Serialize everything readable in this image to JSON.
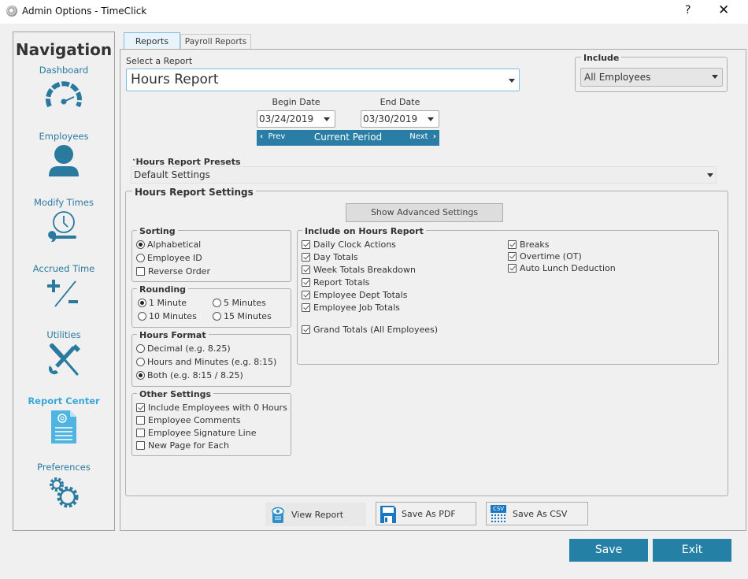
{
  "window": {
    "title": "Admin Options - TimeClick",
    "help_label": "?",
    "close_label": "✕"
  },
  "navigation": {
    "title": "Navigation",
    "items": [
      {
        "label": "Dashboard",
        "icon": "speedometer-icon",
        "active": false
      },
      {
        "label": "Employees",
        "icon": "person-icon",
        "active": false
      },
      {
        "label": "Modify Times",
        "icon": "clock-wrench-icon",
        "active": false
      },
      {
        "label": "Accrued Time",
        "icon": "plus-minus-icon",
        "active": false
      },
      {
        "label": "Utilities",
        "icon": "tools-icon",
        "active": false
      },
      {
        "label": "Report Center",
        "icon": "report-document-icon",
        "active": true
      },
      {
        "label": "Preferences",
        "icon": "gears-icon",
        "active": false
      }
    ]
  },
  "tabs": [
    {
      "label": "Reports",
      "active": true
    },
    {
      "label": "Payroll Reports",
      "active": false
    }
  ],
  "report": {
    "select_label": "Select a Report",
    "selected": "Hours Report"
  },
  "include": {
    "legend": "Include",
    "selected": "All Employees"
  },
  "dates": {
    "begin_label": "Begin Date",
    "begin_value": "03/24/2019",
    "end_label": "End Date",
    "end_value": "03/30/2019",
    "prev_label": "Prev",
    "current_label": "Current Period",
    "next_label": "Next"
  },
  "presets": {
    "label": "Hours Report Presets",
    "selected": "Default Settings"
  },
  "settings": {
    "legend": "Hours Report Settings",
    "advanced_button": "Show Advanced Settings",
    "sorting": {
      "legend": "Sorting",
      "options": [
        {
          "label": "Alphabetical",
          "type": "radio",
          "checked": true
        },
        {
          "label": "Employee ID",
          "type": "radio",
          "checked": false
        },
        {
          "label": "Reverse Order",
          "type": "checkbox",
          "checked": false
        }
      ]
    },
    "rounding": {
      "legend": "Rounding",
      "options": [
        {
          "label": "1 Minute",
          "checked": true
        },
        {
          "label": "5 Minutes",
          "checked": false
        },
        {
          "label": "10 Minutes",
          "checked": false
        },
        {
          "label": "15 Minutes",
          "checked": false
        }
      ]
    },
    "hours_format": {
      "legend": "Hours Format",
      "options": [
        {
          "label": "Decimal (e.g. 8.25)",
          "checked": false
        },
        {
          "label": "Hours and Minutes (e.g. 8:15)",
          "checked": false
        },
        {
          "label": "Both (e.g. 8:15 / 8.25)",
          "checked": true
        }
      ]
    },
    "other": {
      "legend": "Other Settings",
      "options": [
        {
          "label": "Include Employees with 0 Hours",
          "checked": true
        },
        {
          "label": "Employee Comments",
          "checked": false
        },
        {
          "label": "Employee Signature Line",
          "checked": false
        },
        {
          "label": "New Page for Each",
          "checked": false
        }
      ]
    },
    "include_on_report": {
      "legend": "Include on Hours Report",
      "left_column": [
        {
          "label": "Daily Clock Actions",
          "checked": true
        },
        {
          "label": "Day Totals",
          "checked": true
        },
        {
          "label": "Week Totals Breakdown",
          "checked": true
        },
        {
          "label": "Report Totals",
          "checked": true
        },
        {
          "label": "Employee Dept Totals",
          "checked": true
        },
        {
          "label": "Employee Job Totals",
          "checked": true
        }
      ],
      "grand_totals": {
        "label": "Grand Totals (All Employees)",
        "checked": true
      },
      "right_column": [
        {
          "label": "Breaks",
          "checked": true
        },
        {
          "label": "Overtime (OT)",
          "checked": true
        },
        {
          "label": "Auto Lunch Deduction",
          "checked": true
        }
      ]
    }
  },
  "actions": {
    "view_report": "View Report",
    "save_pdf": "Save As PDF",
    "save_csv": "Save As CSV",
    "csv_icon_text": "CSV"
  },
  "footer": {
    "save": "Save",
    "exit": "Exit"
  },
  "colors": {
    "accent": "#2580a6",
    "nav_link": "#2a7aa0",
    "nav_active": "#3aa8d8"
  }
}
